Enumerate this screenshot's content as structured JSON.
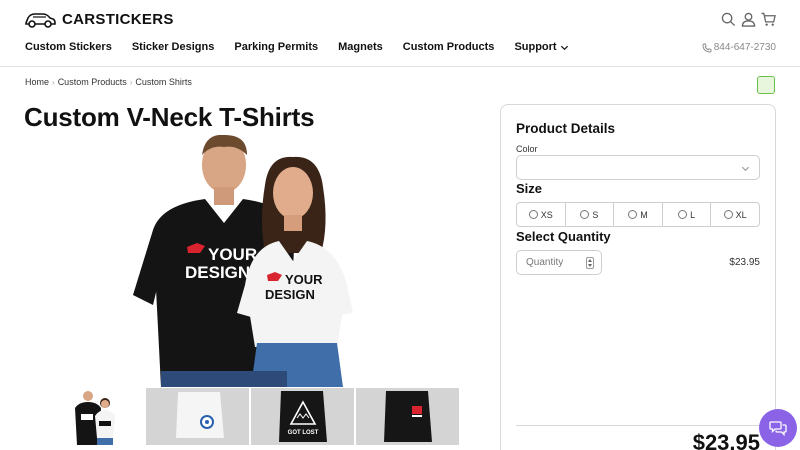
{
  "brand": {
    "name": "CARSTICKERS",
    "icon": "car-logo-icon"
  },
  "header": {
    "icons": [
      "search-icon",
      "account-icon",
      "cart-icon"
    ],
    "phone": "844-647-2730",
    "nav": [
      {
        "label": "Custom Stickers"
      },
      {
        "label": "Sticker Designs"
      },
      {
        "label": "Parking Permits"
      },
      {
        "label": "Magnets"
      },
      {
        "label": "Custom Products"
      },
      {
        "label": "Support",
        "has_dropdown": true
      }
    ]
  },
  "breadcrumb": [
    "Home",
    "Custom Products",
    "Custom Shirts"
  ],
  "page_title": "Custom V-Neck T-Shirts",
  "main_image": {
    "tshirt_print_line1": "YOUR",
    "tshirt_print_line2": "DESIGN"
  },
  "thumbnails": [
    {
      "name": "thumb-couple"
    },
    {
      "name": "thumb-white-folded"
    },
    {
      "name": "thumb-black-got-lost",
      "print": "GOT LOST"
    },
    {
      "name": "thumb-black-pocket"
    }
  ],
  "product_details": {
    "title": "Product Details",
    "color_label": "Color",
    "color_value": "",
    "size_label": "Size",
    "sizes": [
      "XS",
      "S",
      "M",
      "L",
      "XL"
    ],
    "quantity_label": "Select Quantity",
    "quantity_placeholder": "Quantity",
    "unit_price": "$23.95",
    "total_price": "$23.95"
  },
  "colors": {
    "brand_purple": "#8b63e6",
    "accent_green": "#6ac14a",
    "print_red": "#d9232e"
  }
}
